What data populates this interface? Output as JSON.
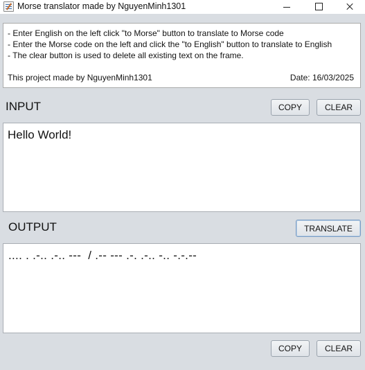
{
  "window": {
    "title": "Morse translator made by NguyenMinh1301",
    "icon": "app-icon"
  },
  "info": {
    "lines": [
      "- Enter English on the left click \"to Morse\" button to translate to Morse code",
      "- Enter the Morse code on the left and click the \"to English\" button to translate to English",
      "- The clear button is used to delete all existing text on the frame."
    ],
    "credit": "This project made by NguyenMinh1301",
    "date": "Date: 16/03/2025"
  },
  "input": {
    "label": "INPUT",
    "copy_label": "COPY",
    "clear_label": "CLEAR",
    "text": "Hello World!"
  },
  "output": {
    "label": "OUTPUT",
    "translate_label": "TRANSLATE",
    "text": ".... . .-.. .-.. ---  / .-- --- .-. .-.. -.. -.-.--",
    "copy_label": "COPY",
    "clear_label": "CLEAR"
  }
}
